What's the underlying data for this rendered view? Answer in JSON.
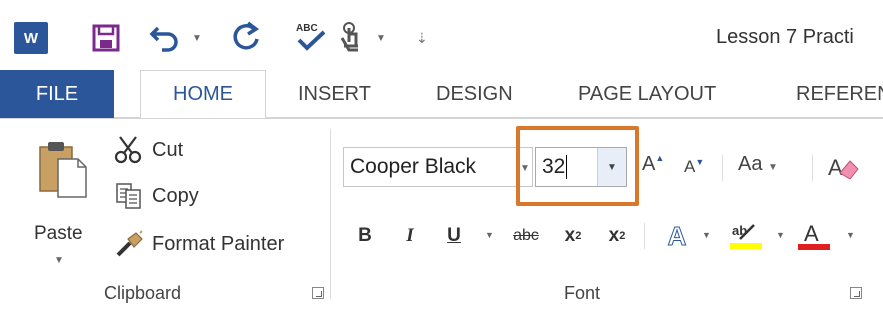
{
  "title_bar": {
    "app_icon_letter": "W",
    "document_title": "Lesson 7 Practi",
    "spelling_icon_text": "ABC"
  },
  "tabs": [
    {
      "label": "FILE"
    },
    {
      "label": "HOME"
    },
    {
      "label": "INSERT"
    },
    {
      "label": "DESIGN"
    },
    {
      "label": "PAGE LAYOUT"
    },
    {
      "label": "REFEREN"
    }
  ],
  "clipboard": {
    "paste_label": "Paste",
    "cut_label": "Cut",
    "copy_label": "Copy",
    "format_painter_label": "Format Painter",
    "group_label": "Clipboard"
  },
  "font": {
    "font_name": "Cooper Black",
    "font_size": "32",
    "grow_label": "A",
    "shrink_label": "A",
    "change_case_label": "Aa",
    "bold_label": "B",
    "italic_label": "I",
    "underline_label": "U",
    "strikethrough_label": "abc",
    "subscript_label": "x",
    "subscript_suffix": "2",
    "superscript_label": "x",
    "superscript_suffix": "2",
    "text_effects_label": "A",
    "highlight_label": "ab",
    "font_color_label": "A",
    "group_label": "Font"
  },
  "colors": {
    "accent": "#2b579a",
    "callout": "#d9772b",
    "highlight_yellow": "#ffff00",
    "font_color_red": "#e02020"
  }
}
